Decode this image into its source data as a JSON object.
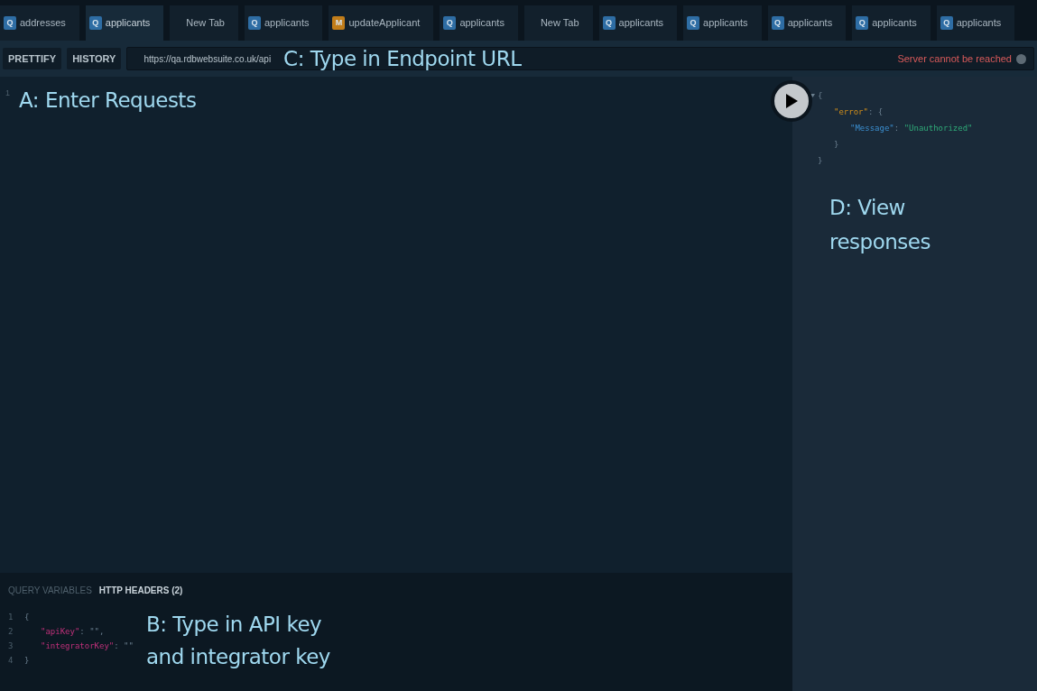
{
  "tabs": [
    {
      "badge": "Q",
      "color": "#2e6da4",
      "label": "addresses",
      "selected": false
    },
    {
      "badge": "Q",
      "color": "#2e6da4",
      "label": "applicants",
      "selected": true
    },
    {
      "label": "New Tab",
      "selected": false
    },
    {
      "badge": "Q",
      "color": "#2e6da4",
      "label": "applicants",
      "selected": false
    },
    {
      "badge": "M",
      "color": "#c17d1a",
      "label": "updateApplicant",
      "selected": false
    },
    {
      "badge": "Q",
      "color": "#2e6da4",
      "label": "applicants",
      "selected": false
    },
    {
      "label": "New Tab",
      "selected": false
    },
    {
      "badge": "Q",
      "color": "#2e6da4",
      "label": "applicants",
      "selected": false
    },
    {
      "badge": "Q",
      "color": "#2e6da4",
      "label": "applicants",
      "selected": false
    },
    {
      "badge": "Q",
      "color": "#2e6da4",
      "label": "applicants",
      "selected": false
    },
    {
      "badge": "Q",
      "color": "#2e6da4",
      "label": "applicants",
      "selected": false
    },
    {
      "badge": "Q",
      "color": "#2e6da4",
      "label": "applicants",
      "selected": false
    }
  ],
  "toolbar": {
    "buttons": [
      "PRETTIFY",
      "HISTORY"
    ],
    "url": "https://qa.rdbwebsuite.co.uk/api",
    "annotation": "C: Type in Endpoint URL",
    "status": "Server cannot be reached"
  },
  "editor": {
    "line_numbers": [
      "1"
    ],
    "annotation": "A: Enter Requests"
  },
  "response": {
    "lines": [
      {
        "tokens": [
          {
            "kind": "punct",
            "text": "{"
          }
        ],
        "children": [
          {
            "tokens": [
              {
                "kind": "key",
                "text": "\"error\""
              },
              {
                "kind": "punct",
                "text": ": {"
              }
            ],
            "children": [
              {
                "tokens": [
                  {
                    "kind": "prop",
                    "text": "\"Message\""
                  },
                  {
                    "kind": "punct",
                    "text": ": "
                  },
                  {
                    "kind": "string",
                    "text": "\"Unauthorized\""
                  }
                ]
              }
            ]
          },
          {
            "tokens": [
              {
                "kind": "punct",
                "text": "}"
              }
            ]
          }
        ]
      },
      {
        "tokens": [
          {
            "kind": "punct",
            "text": "}"
          }
        ]
      }
    ],
    "annotation": "D: View responses"
  },
  "variables": {
    "tabs": [
      {
        "label": "QUERY VARIABLES",
        "selected": false
      },
      {
        "label": "HTTP HEADERS (2)",
        "selected": true
      }
    ],
    "lines": [
      {
        "number": "1",
        "tokens": [
          {
            "kind": "punct",
            "text": "{"
          }
        ],
        "children": [
          {
            "number": "2",
            "tokens": [
              {
                "kind": "attr",
                "text": "\"apiKey\""
              },
              {
                "kind": "punct",
                "text": ": \"\","
              }
            ]
          },
          {
            "number": "3",
            "tokens": [
              {
                "kind": "attr",
                "text": "\"integratorKey\""
              },
              {
                "kind": "punct",
                "text": ": \"\""
              }
            ]
          }
        ]
      },
      {
        "number": "4",
        "tokens": [
          {
            "kind": "punct",
            "text": "}"
          }
        ]
      }
    ],
    "annotation": "B: Type in API key and integrator key"
  }
}
